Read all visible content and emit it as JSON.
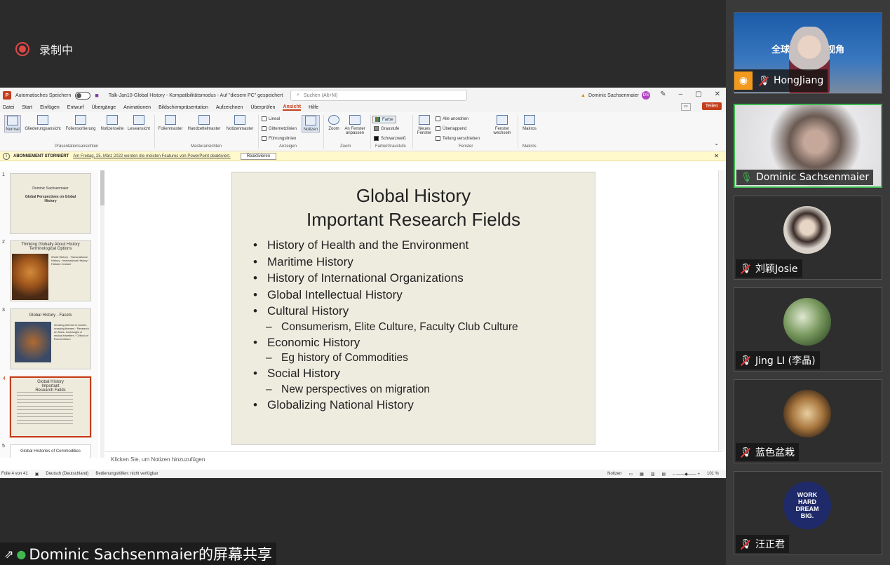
{
  "recording": {
    "label": "录制中"
  },
  "share_banner": {
    "text": "Dominic Sachsenmaier的屏幕共享"
  },
  "ppt": {
    "autosave_label": "Automatisches Speichern",
    "file_title": "Talk-Jan10-Global History  -  Kompatibilitätsmodus  -  Auf \"diesem PC\" gespeichert",
    "search_placeholder": "Suchen (Alt+M)",
    "user_name": "Dominic Sachsenmaier",
    "user_initials": "DS",
    "menu": [
      "Datei",
      "Start",
      "Einfügen",
      "Entwurf",
      "Übergänge",
      "Animationen",
      "Bildschirmpräsentation",
      "Aufzeichnen",
      "Überprüfen",
      "Ansicht",
      "Hilfe"
    ],
    "active_menu": "Ansicht",
    "share_button": "Teilen",
    "ribbon": {
      "normal": "Normal",
      "gliederung": "Gliederungsansicht",
      "foliensortierung": "Foliensortierung",
      "notizseite": "Notizenseite",
      "leseansicht": "Leseansicht",
      "folienmaster": "Folienmaster",
      "handzettelmaster": "Handzettelmaster",
      "notizenmaster": "Notizenmaster",
      "lineal": "Lineal",
      "gitternetz": "Gitternetzlinien",
      "fuehrung": "Führungslinien",
      "notizen": "Notizen",
      "zoom": "Zoom",
      "an_fenster": "An Fenster anpassen",
      "farbe": "Farbe",
      "graustufe": "Graustufe",
      "schwarzweiss": "Schwarzweiß",
      "neues_fenster": "Neues Fenster",
      "alle_anordnen": "Alle anordnen",
      "ueberlappend": "Überlappend",
      "teilung": "Teilung verschieben",
      "fenster_wechseln": "Fenster wechseln",
      "makros": "Makros",
      "grp_praesentation": "Präsentationsansichten",
      "grp_master": "Masteransichten",
      "grp_anzeigen": "Anzeigen",
      "grp_zoom": "Zoom",
      "grp_farbe": "Farbe/Graustufe",
      "grp_fenster": "Fenster",
      "grp_makros": "Makros"
    },
    "notice": {
      "label": "ABONNEMENT STORNIERT",
      "message": "Am Freitag, 25. März 2022 werden die meisten Features von PowerPoint deaktiviert.",
      "button": "Reaktivieren"
    },
    "thumbnails": [
      {
        "num": "1",
        "author": "Dominic Sachsenmaier",
        "title": "Global Perspectives on Global History"
      },
      {
        "num": "2",
        "title": "Thinking Globally About History Terminological Options",
        "bullets": "World History · Transnational History · International History · Histoire Croisee"
      },
      {
        "num": "3",
        "title": "Global History - Facets",
        "bullets": "Growing interest in border-crossing themes · Research on flows, exchanges & mutual transfers · Critical of Eurocentrism"
      },
      {
        "num": "4",
        "title": "Global History Important Research Fields"
      },
      {
        "num": "5",
        "title": "Global Histories of Commodities"
      }
    ],
    "slide": {
      "title1": "Global History",
      "title2": "Important Research Fields",
      "bullets": [
        {
          "text": "History of Health and the Environment",
          "level": 1
        },
        {
          "text": "Maritime History",
          "level": 1
        },
        {
          "text": "History of International Organizations",
          "level": 1
        },
        {
          "text": "Global Intellectual History",
          "level": 1
        },
        {
          "text": "Cultural History",
          "level": 1
        },
        {
          "text": "Consumerism, Elite Culture, Faculty Club Culture",
          "level": 2
        },
        {
          "text": "Economic History",
          "level": 1
        },
        {
          "text": "Eg history of Commodities",
          "level": 2
        },
        {
          "text": "Social History",
          "level": 1
        },
        {
          "text": "New perspectives on migration",
          "level": 2
        },
        {
          "text": "Globalizing National History",
          "level": 1
        }
      ]
    },
    "notes_placeholder": "Klicken Sie, um Notizen hinzuzufügen",
    "status": {
      "slide": "Folie 4 von 41",
      "language": "Deutsch (Deutschland)",
      "accessibility": "Bedienungshilfen: nicht verfügbar",
      "notes": "Notizen",
      "zoom": "101 %"
    }
  },
  "participants": [
    {
      "name": "HongJiang",
      "mic": "off",
      "banner_title": "全球史的全球视角"
    },
    {
      "name": "Dominic Sachsenmaier",
      "mic": "on"
    },
    {
      "name": "刘颖Josie",
      "mic": "off"
    },
    {
      "name": "Jing LI (李晶)",
      "mic": "off"
    },
    {
      "name": "蓝色盆栽",
      "mic": "off"
    },
    {
      "name": "汪正君",
      "mic": "off",
      "avatar_text": "WORK HARD DREAM BIG."
    }
  ]
}
